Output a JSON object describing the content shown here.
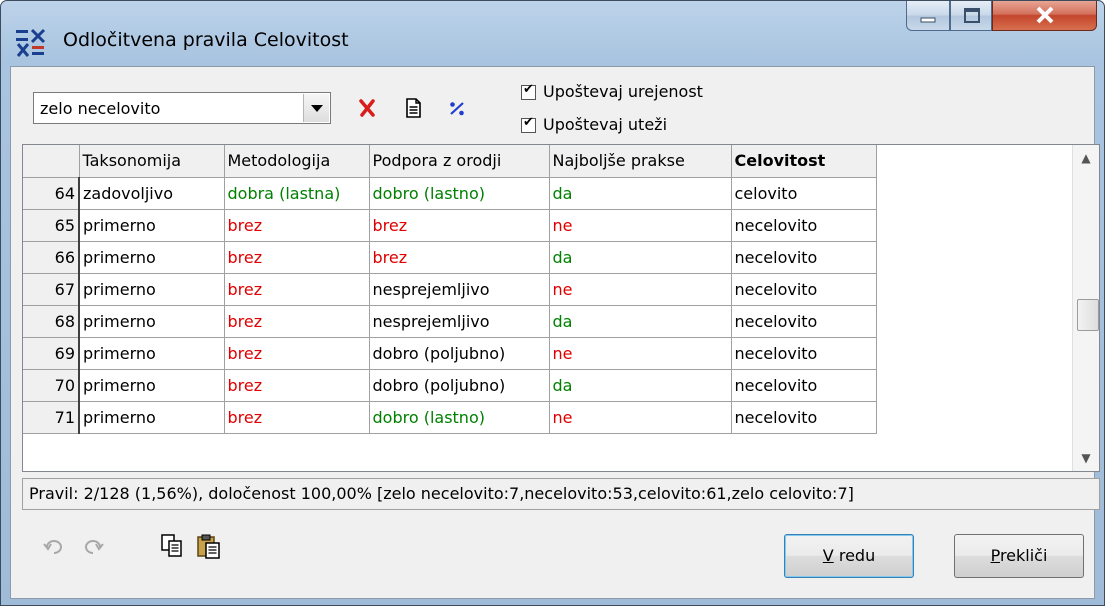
{
  "window": {
    "title": "Odločitvena pravila Celovitost",
    "minimize_glyph": "—",
    "maximize_glyph": "▫",
    "close_glyph": "X"
  },
  "toolbar": {
    "combo_value": "zelo necelovito",
    "delete_icon": "red-x-icon",
    "document_icon": "document-icon",
    "percent_icon": "percent-icon",
    "checkbox1_label": "Upoštevaj urejenost",
    "checkbox1_checked": true,
    "checkbox2_label": "Upoštevaj uteži",
    "checkbox2_checked": true
  },
  "grid": {
    "columns": [
      "Taksonomija",
      "Metodologija",
      "Podpora z orodji",
      "Najboljše prakse",
      "Celovitost"
    ],
    "rows": [
      {
        "num": "64",
        "cells": [
          [
            "zadovoljivo",
            "black"
          ],
          [
            "dobra (lastna)",
            "green"
          ],
          [
            "dobro (lastno)",
            "green"
          ],
          [
            "da",
            "green"
          ],
          [
            "celovito",
            "black"
          ]
        ]
      },
      {
        "num": "65",
        "cells": [
          [
            "primerno",
            "black"
          ],
          [
            "brez",
            "red"
          ],
          [
            "brez",
            "red"
          ],
          [
            "ne",
            "red"
          ],
          [
            "necelovito",
            "black"
          ]
        ]
      },
      {
        "num": "66",
        "cells": [
          [
            "primerno",
            "black"
          ],
          [
            "brez",
            "red"
          ],
          [
            "brez",
            "red"
          ],
          [
            "da",
            "green"
          ],
          [
            "necelovito",
            "black"
          ]
        ]
      },
      {
        "num": "67",
        "cells": [
          [
            "primerno",
            "black"
          ],
          [
            "brez",
            "red"
          ],
          [
            "nesprejemljivo",
            "black"
          ],
          [
            "ne",
            "red"
          ],
          [
            "necelovito",
            "black"
          ]
        ]
      },
      {
        "num": "68",
        "cells": [
          [
            "primerno",
            "black"
          ],
          [
            "brez",
            "red"
          ],
          [
            "nesprejemljivo",
            "black"
          ],
          [
            "da",
            "green"
          ],
          [
            "necelovito",
            "black"
          ]
        ]
      },
      {
        "num": "69",
        "cells": [
          [
            "primerno",
            "black"
          ],
          [
            "brez",
            "red"
          ],
          [
            "dobro (poljubno)",
            "black"
          ],
          [
            "ne",
            "red"
          ],
          [
            "necelovito",
            "black"
          ]
        ]
      },
      {
        "num": "70",
        "cells": [
          [
            "primerno",
            "black"
          ],
          [
            "brez",
            "red"
          ],
          [
            "dobro (poljubno)",
            "black"
          ],
          [
            "da",
            "green"
          ],
          [
            "necelovito",
            "black"
          ]
        ]
      },
      {
        "num": "71",
        "cells": [
          [
            "primerno",
            "black"
          ],
          [
            "brez",
            "red"
          ],
          [
            "dobro (lastno)",
            "green"
          ],
          [
            "ne",
            "red"
          ],
          [
            "necelovito",
            "black"
          ]
        ]
      }
    ],
    "colors": {
      "green": "#008000",
      "red": "#e00000",
      "black": "#000000"
    }
  },
  "status": {
    "text": "Pravil: 2/128 (1,56%), določenost 100,00% [zelo necelovito:7,necelovito:53,celovito:61,zelo celovito:7]"
  },
  "bottom": {
    "undo_icon": "undo-icon",
    "redo_icon": "redo-icon",
    "copy_icon": "copy-icon",
    "paste_icon": "paste-icon",
    "ok_access_key": "V",
    "ok_rest": " redu",
    "cancel_access_key": "P",
    "cancel_rest": "rekliči"
  }
}
